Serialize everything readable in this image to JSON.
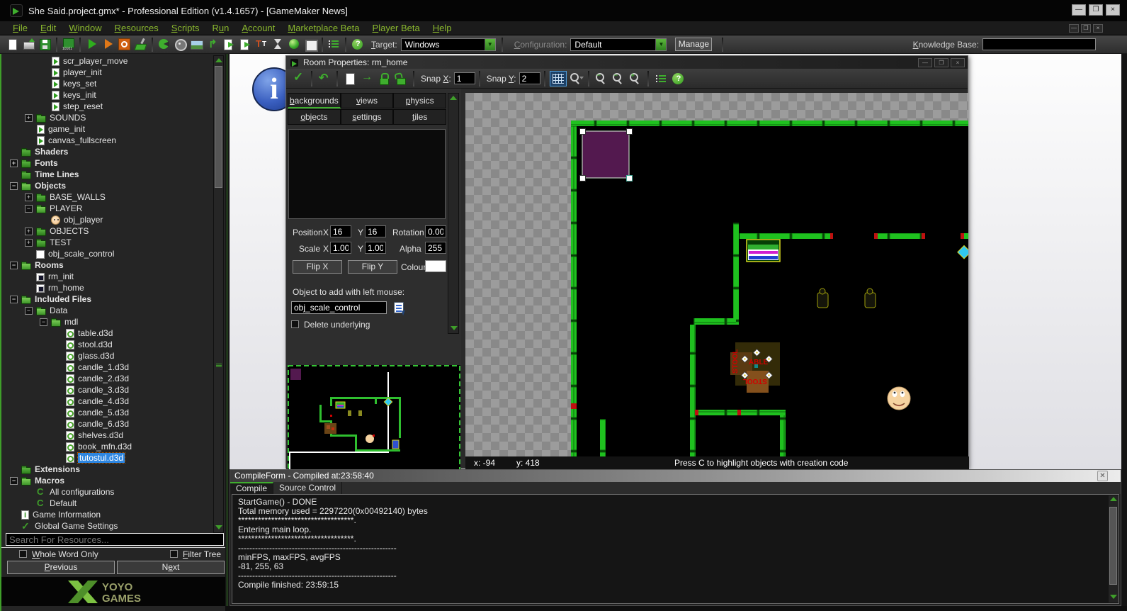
{
  "titlebar": {
    "title": "She Said.project.gmx*  -  Professional Edition (v1.4.1657)   - [GameMaker News]"
  },
  "menus": [
    {
      "label": "File",
      "u": 0
    },
    {
      "label": "Edit",
      "u": 0
    },
    {
      "label": "Window",
      "u": 0
    },
    {
      "label": "Resources",
      "u": 0
    },
    {
      "label": "Scripts",
      "u": 0
    },
    {
      "label": "Run",
      "u": 1
    },
    {
      "label": "Account",
      "u": 0
    },
    {
      "label": "Marketplace Beta",
      "u": 0
    },
    {
      "label": "Player Beta",
      "u": 0
    },
    {
      "label": "Help",
      "u": 0
    }
  ],
  "toolbar": {
    "icons": [
      "new-file",
      "open-project",
      "save-project",
      "sep",
      "create-executable",
      "sep",
      "run",
      "run-debug",
      "stop",
      "clean-cache",
      "sep",
      "new-sprite",
      "new-sound",
      "new-background",
      "new-path",
      "new-script",
      "new-shader",
      "new-font",
      "new-timeline",
      "new-object",
      "new-room",
      "sep",
      "resource-tree",
      "sep",
      "help"
    ],
    "target_label": {
      "label": "Target:",
      "u": 0
    },
    "target_value": "Windows",
    "config_label": {
      "label": "Configuration:",
      "u": 0
    },
    "config_value": "Default",
    "manage_label": "Manage",
    "kb_label": {
      "label": "Knowledge Base:",
      "u": 0
    }
  },
  "tree": {
    "items": [
      {
        "label": "scr_player_move",
        "icon": "script-icon",
        "depth": 3
      },
      {
        "label": "player_init",
        "icon": "script-icon",
        "depth": 3
      },
      {
        "label": "keys_set",
        "icon": "script-icon",
        "depth": 3
      },
      {
        "label": "keys_init",
        "icon": "script-icon",
        "depth": 3
      },
      {
        "label": "step_reset",
        "icon": "script-icon",
        "depth": 3
      },
      {
        "label": "SOUNDS",
        "icon": "folder-icon",
        "depth": 2,
        "exp": "+"
      },
      {
        "label": "game_init",
        "icon": "script-icon",
        "depth": 2
      },
      {
        "label": "canvas_fullscreen",
        "icon": "script-icon",
        "depth": 2
      },
      {
        "label": "Shaders",
        "icon": "folder-icon",
        "depth": 1,
        "bold": true
      },
      {
        "label": "Fonts",
        "icon": "folder-icon",
        "depth": 1,
        "bold": true,
        "exp": "+"
      },
      {
        "label": "Time Lines",
        "icon": "folder-icon",
        "depth": 1,
        "bold": true
      },
      {
        "label": "Objects",
        "icon": "folder-open-icon",
        "depth": 1,
        "bold": true,
        "exp": "-"
      },
      {
        "label": "BASE_WALLS",
        "icon": "folder-icon",
        "depth": 2,
        "exp": "+"
      },
      {
        "label": "PLAYER",
        "icon": "folder-open-icon",
        "depth": 2,
        "exp": "-"
      },
      {
        "label": "obj_player",
        "icon": "object-face-icon",
        "depth": 3
      },
      {
        "label": "OBJECTS",
        "icon": "folder-icon",
        "depth": 2,
        "exp": "+"
      },
      {
        "label": "TEST",
        "icon": "folder-icon",
        "depth": 2,
        "exp": "+"
      },
      {
        "label": "obj_scale_control",
        "icon": "white-square-icon",
        "depth": 2
      },
      {
        "label": "Rooms",
        "icon": "folder-open-icon",
        "depth": 1,
        "bold": true,
        "exp": "-"
      },
      {
        "label": "rm_init",
        "icon": "room-icon",
        "depth": 2
      },
      {
        "label": "rm_home",
        "icon": "room-icon",
        "depth": 2
      },
      {
        "label": "Included Files",
        "icon": "folder-open-icon",
        "depth": 1,
        "bold": true,
        "exp": "-"
      },
      {
        "label": "Data",
        "icon": "folder-open-icon",
        "depth": 2,
        "exp": "-"
      },
      {
        "label": "mdl",
        "icon": "folder-open-icon",
        "depth": 3,
        "exp": "-"
      },
      {
        "label": "table.d3d",
        "icon": "included-file-icon",
        "depth": 4
      },
      {
        "label": "stool.d3d",
        "icon": "included-file-icon",
        "depth": 4
      },
      {
        "label": "glass.d3d",
        "icon": "included-file-icon",
        "depth": 4
      },
      {
        "label": "candle_1.d3d",
        "icon": "included-file-icon",
        "depth": 4
      },
      {
        "label": "candle_2.d3d",
        "icon": "included-file-icon",
        "depth": 4
      },
      {
        "label": "candle_3.d3d",
        "icon": "included-file-icon",
        "depth": 4
      },
      {
        "label": "candle_4.d3d",
        "icon": "included-file-icon",
        "depth": 4
      },
      {
        "label": "candle_5.d3d",
        "icon": "included-file-icon",
        "depth": 4
      },
      {
        "label": "candle_6.d3d",
        "icon": "included-file-icon",
        "depth": 4
      },
      {
        "label": "shelves.d3d",
        "icon": "included-file-icon",
        "depth": 4
      },
      {
        "label": "book_mfn.d3d",
        "icon": "included-file-icon",
        "depth": 4
      },
      {
        "label": "tutostul.d3d",
        "icon": "included-file-icon",
        "depth": 4,
        "selected": true
      },
      {
        "label": "Extensions",
        "icon": "folder-icon",
        "depth": 1,
        "bold": true
      },
      {
        "label": "Macros",
        "icon": "folder-open-icon",
        "depth": 1,
        "bold": true,
        "exp": "-"
      },
      {
        "label": "All configurations",
        "icon": "config-icon",
        "depth": 2
      },
      {
        "label": "Default",
        "icon": "config-icon",
        "depth": 2
      },
      {
        "label": "Game Information",
        "icon": "info-icon",
        "depth": 1
      },
      {
        "label": "Global Game Settings",
        "icon": "settings-check-icon",
        "depth": 1
      }
    ]
  },
  "search": {
    "placeholder": "Search For Resources..."
  },
  "filters": {
    "whole_word": {
      "label": "Whole Word Only",
      "u": 0
    },
    "filter_tree": {
      "label": "Filter Tree",
      "u": 0
    }
  },
  "nav_buttons": {
    "previous": {
      "label": "Previous",
      "u": 0
    },
    "next": {
      "label": "Next",
      "u": 1
    }
  },
  "logo": {
    "line1": "YOYO",
    "line2": "GAMES"
  },
  "room": {
    "title": "Room Properties: rm_home",
    "toolbar_icons_left": [
      "confirm",
      "sep",
      "undo",
      "sep",
      "new-page",
      "goto",
      "lock",
      "unlock",
      "sep"
    ],
    "toolbar_icons_mid": [
      "grid",
      "zoom-menu",
      "sep",
      "zoom-out",
      "zoom-reset",
      "zoom-in",
      "sep",
      "resource-list",
      "help"
    ],
    "snap_x": {
      "label": "Snap X:",
      "u": 5,
      "value": "1"
    },
    "snap_y": {
      "label": "Snap Y:",
      "u": 5,
      "value": "2"
    },
    "tabs_row1": [
      {
        "label": "backgrounds",
        "u": 0
      },
      {
        "label": "views",
        "u": 0
      },
      {
        "label": "physics",
        "u": 0
      }
    ],
    "tabs_row2": [
      {
        "label": "objects",
        "u": 0
      },
      {
        "label": "settings",
        "u": 0
      },
      {
        "label": "tiles",
        "u": 0
      }
    ],
    "active_tab": "objects",
    "fields": {
      "position_label": "Position",
      "x_label": "X",
      "y_label": "Y",
      "rotation_label": "Rotation",
      "position_x": "16",
      "position_y": "16",
      "rotation": "0.00",
      "scale_label": "Scale",
      "scale_x": "1.00",
      "scale_y": "1.00",
      "alpha_label": "Alpha",
      "alpha": "255",
      "flip_x": "Flip X",
      "flip_y": "Flip Y",
      "colour_label": "Colour",
      "colour_value": "#ffffff"
    },
    "object_add_label": "Object to add with left mouse:",
    "object_add_value": "obj_scale_control",
    "delete_underlying": "Delete underlying",
    "status": {
      "x": "x: -94",
      "y": "y: 418",
      "hint": "Press C to highlight objects with creation code"
    },
    "canvas_labels": {
      "stool_left": "STOOL",
      "table": "ABLE",
      "stool_bottom": "STOOL"
    },
    "accent_colors": {
      "wall_green": "#1fc11f",
      "selection_purple": "#53194f",
      "marker_red": "#d00000"
    }
  },
  "compile": {
    "header": "CompileForm - Compiled at:23:58:40",
    "tabs": [
      "Compile",
      "Source Control"
    ],
    "active_tab": "Compile",
    "lines": [
      "StartGame() - DONE",
      "Total memory used = 2297220(0x00492140) bytes",
      "***********************************.",
      "Entering main loop.",
      "***********************************.",
      "--------------------------------------------------------",
      "minFPS, maxFPS, avgFPS",
      "-81, 255, 63",
      "--------------------------------------------------------",
      "Compile finished: 23:59:15"
    ]
  }
}
